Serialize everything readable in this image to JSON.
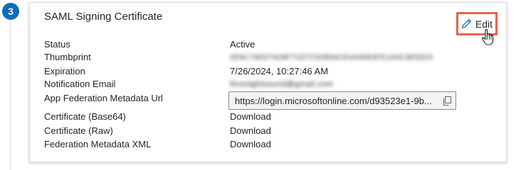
{
  "step": {
    "number": "3",
    "badge_color": "#0f6cbd"
  },
  "card": {
    "title": "SAML Signing Certificate",
    "edit_label": "Edit",
    "edit_icon": "pencil-icon",
    "highlight_color": "#e8624a"
  },
  "fields": {
    "status": {
      "label": "Status",
      "value": "Active"
    },
    "thumbprint": {
      "label": "Thumbprint",
      "value": "2E9C74ED7A28F71D7C52B5ACE4A30E9FE1A3C3E5D24"
    },
    "expiration": {
      "label": "Expiration",
      "value": "7/26/2024, 10:27:46 AM"
    },
    "notification_email": {
      "label": "Notification Email",
      "value": "foresightsound@gmail.com"
    },
    "metadata_url": {
      "label": "App Federation Metadata Url",
      "value": "https://login.microsoftonline.com/d93523e1-9b...",
      "icon": "copy-icon"
    },
    "cert_base64": {
      "label": "Certificate (Base64)",
      "action": "Download"
    },
    "cert_raw": {
      "label": "Certificate (Raw)",
      "action": "Download"
    },
    "federation_xml": {
      "label": "Federation Metadata XML",
      "action": "Download"
    }
  },
  "colors": {
    "link": "#0f6cbd"
  }
}
